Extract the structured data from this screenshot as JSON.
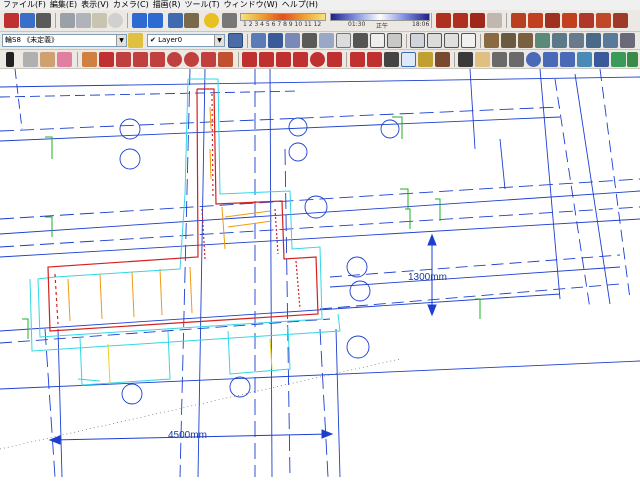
{
  "app": {
    "menu": [
      {
        "name": "menu-file",
        "label": "ファイル(F)"
      },
      {
        "name": "menu-edit",
        "label": "編集(E)"
      },
      {
        "name": "menu-view",
        "label": "表示(V)"
      },
      {
        "name": "menu-camera",
        "label": "カメラ(C)"
      },
      {
        "name": "menu-draw",
        "label": "描画(R)"
      },
      {
        "name": "menu-tools",
        "label": "ツール(T)"
      },
      {
        "name": "menu-window",
        "label": "ウィンドウ(W)"
      },
      {
        "name": "menu-help",
        "label": "ヘルプ(H)"
      }
    ]
  },
  "toolbar1": {
    "months": "1 2 3 4 5 6 7 8 9 10 11 12",
    "time_start": "01:30",
    "time_noon": "正午",
    "time_end": "18:06"
  },
  "toolbar2": {
    "layer_select": "輪S8 《未定義》",
    "current_layer": "Layer0",
    "layer_checked": "✔"
  },
  "viewport": {
    "dimensions": [
      {
        "name": "dimension-1300mm",
        "label": "1300mm"
      },
      {
        "name": "dimension-4500mm",
        "label": "4500mm"
      }
    ]
  },
  "colors": {
    "blue_lines": "#1c3fd1",
    "cyan_lines": "#33d6e6",
    "red_lines": "#d42020",
    "orange_lines": "#f09a10",
    "green_lines": "#22b022",
    "dim_text": "#1a3a9a"
  }
}
